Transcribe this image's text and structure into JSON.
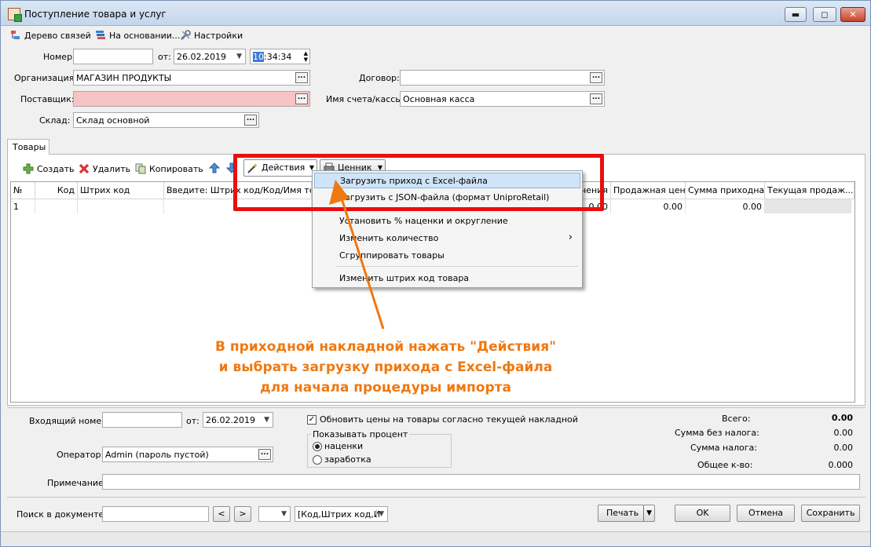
{
  "window": {
    "title": "Поступление товара и услуг",
    "min": "▬",
    "max": "◻",
    "close": "✕"
  },
  "toolbar": {
    "tree": "Дерево связей",
    "based_on": "На основании...",
    "settings": "Настройки"
  },
  "header": {
    "number_label": "Номер:",
    "number_value": "",
    "date_from_label": "от:",
    "date_value": "26.02.2019",
    "time_hours": "10",
    "time_rest": ":34:34",
    "org_label": "Организация:",
    "org_value": "МАГАЗИН ПРОДУКТЫ",
    "supplier_label": "Поставщик:",
    "supplier_value": "",
    "warehouse_label": "Склад:",
    "warehouse_value": "Склад основной",
    "contract_label": "Договор:",
    "contract_value": "",
    "account_label": "Имя счета/кассы:",
    "account_value": "Основная касса"
  },
  "tabs": {
    "goods": "Товары"
  },
  "grid_toolbar": {
    "create": "Создать",
    "delete": "Удалить",
    "copy": "Копировать",
    "actions": "Действия",
    "price_tag": "Ценник"
  },
  "grid": {
    "columns": [
      "№",
      "Код",
      "Штрих код",
      "Введите: Штрих код/Код/Имя товар",
      "чения",
      "Продажная цена",
      "Сумма приходная",
      "Текущая продаж..."
    ],
    "rows": [
      {
        "num": "1",
        "code": "",
        "barcode": "",
        "name": "",
        "col5": "0.00",
        "sale_price": "0.00",
        "sum_in": "0.00",
        "current": ""
      }
    ]
  },
  "menu": {
    "items": [
      "Загрузить приход с Excel-файла",
      "Загрузить с JSON-файла (формат UniproRetail)",
      "Установить % наценки и округление",
      "Изменить количество",
      "Сгруппировать товары",
      "Изменить штрих код товара"
    ],
    "submenu_arrow": "›"
  },
  "annotation": {
    "line1": "В приходной накладной нажать \"Действия\"",
    "line2": "и выбрать загрузку прихода с Excel-файла",
    "line3": "для начала процедуры импорта",
    "color": "#f07810"
  },
  "footer": {
    "incoming_label": "Входящий номер:",
    "incoming_value": "",
    "from_label": "от:",
    "from_date": "26.02.2019",
    "operator_label": "Оператор:",
    "operator_value": "Admin (пароль пустой)",
    "note_label": "Примечание:",
    "note_value": "",
    "update_prices": "Обновить цены на товары согласно текущей накладной",
    "show_percent": "Показывать процент",
    "radio_markup": "наценки",
    "radio_profit": "заработка",
    "total_label": "Всего:",
    "total_value": "0.00",
    "no_tax_label": "Сумма без налога:",
    "no_tax_value": "0.00",
    "tax_label": "Сумма налога:",
    "tax_value": "0.00",
    "qty_label": "Общее к-во:",
    "qty_value": "0.000"
  },
  "bottom": {
    "search_label": "Поиск в документе:",
    "search_value": "",
    "prev": "<",
    "next": ">",
    "search_field": "[Код,Штрих код,И",
    "print": "Печать",
    "ok": "OK",
    "cancel": "Отмена",
    "save": "Сохранить"
  }
}
